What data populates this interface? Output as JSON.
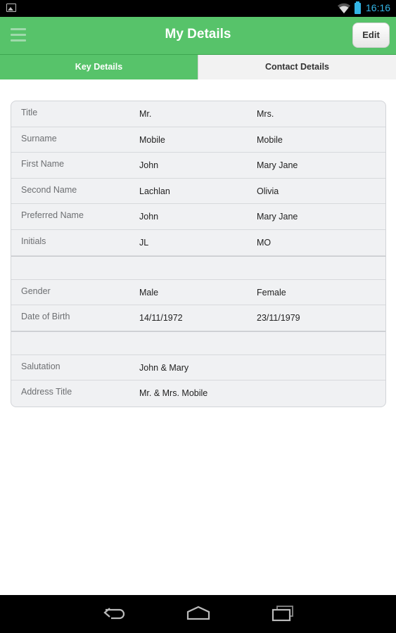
{
  "status_bar": {
    "time": "16:16",
    "accent_color": "#33b5e5",
    "icons": [
      "picture-icon",
      "wifi-icon",
      "battery-icon"
    ]
  },
  "header": {
    "title": "My Details",
    "edit_label": "Edit",
    "color": "#57c36a"
  },
  "tabs": [
    {
      "label": "Key Details",
      "active": true
    },
    {
      "label": "Contact Details",
      "active": false
    }
  ],
  "details": {
    "group1": [
      {
        "label": "Title",
        "v1": "Mr.",
        "v2": "Mrs."
      },
      {
        "label": "Surname",
        "v1": "Mobile",
        "v2": "Mobile"
      },
      {
        "label": "First Name",
        "v1": "John",
        "v2": "Mary Jane"
      },
      {
        "label": "Second Name",
        "v1": "Lachlan",
        "v2": "Olivia"
      },
      {
        "label": "Preferred Name",
        "v1": "John",
        "v2": "Mary Jane"
      },
      {
        "label": "Initials",
        "v1": "JL",
        "v2": "MO"
      }
    ],
    "group2": [
      {
        "label": "Gender",
        "v1": "Male",
        "v2": "Female"
      },
      {
        "label": "Date of Birth",
        "v1": "14/11/1972",
        "v2": "23/11/1979"
      }
    ],
    "group3": [
      {
        "label": "Salutation",
        "v1": "John & Mary"
      },
      {
        "label": "Address Title",
        "v1": "Mr. & Mrs. Mobile"
      }
    ]
  },
  "nav_bar": {
    "icons": [
      "back-icon",
      "home-icon",
      "recent-apps-icon"
    ]
  }
}
